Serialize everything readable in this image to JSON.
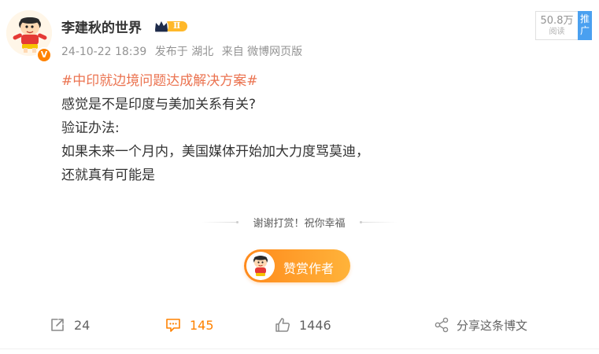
{
  "user": {
    "name": "李建秋的世界",
    "verified_mark": "V",
    "vip_level": "Ⅱ"
  },
  "meta": {
    "datetime": "24-10-22 18:39",
    "location_text": "发布于 湖北",
    "source_text": "来自 微博网页版"
  },
  "stats_box": {
    "views": "50.8万",
    "views_label": "阅读",
    "promote_label": "推广"
  },
  "post": {
    "hashtag": "#中印就边境问题达成解决方案#",
    "lines": [
      "感觉是不是印度与美加关系有关?",
      "验证办法:",
      "如果未来一个月内，美国媒体开始加大力度骂莫迪，",
      "还就真有可能是"
    ]
  },
  "reward": {
    "thanks_text": "谢谢打赏！祝你幸福",
    "button_label": "赞赏作者"
  },
  "actions": {
    "repost_count": "24",
    "comment_count": "145",
    "like_count": "1446",
    "share_label": "分享这条博文"
  },
  "colors": {
    "accent_orange": "#ff8200",
    "hashtag": "#eb7350",
    "promote_blue": "#4aa0f0",
    "text_gray": "#939393"
  },
  "icons": {
    "repost": "repost-icon",
    "comment": "comment-icon",
    "like": "like-icon",
    "share": "share-icon",
    "vip": "crown-icon"
  }
}
